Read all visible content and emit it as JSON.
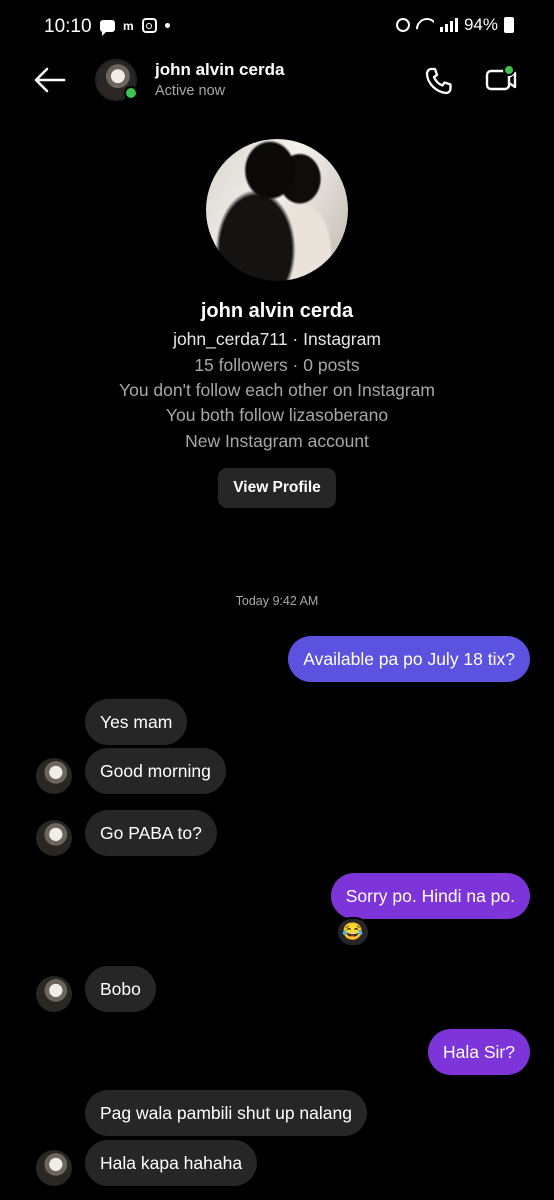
{
  "status_bar": {
    "time": "10:10",
    "battery": "94%",
    "left_icons": [
      "message-icon",
      "m-icon",
      "instagram-icon",
      "dot-icon"
    ],
    "right_icons": [
      "alarm-icon",
      "wifi-icon",
      "signal-icon",
      "battery-icon"
    ],
    "sb_m": "m"
  },
  "header": {
    "name": "john alvin cerda",
    "status": "Active now",
    "icons": [
      "back-arrow-icon",
      "phone-icon",
      "video-call-icon"
    ]
  },
  "profile": {
    "name": "john alvin cerda",
    "handle": "john_cerda711 · Instagram",
    "stats": "15 followers · 0 posts",
    "follow_status": "You don't follow each other on Instagram",
    "mutual": "You both follow lizasoberano",
    "account_note": "New Instagram account",
    "view_profile_label": "View Profile"
  },
  "timestamp": "Today 9:42 AM",
  "messages": [
    {
      "direction": "outgoing",
      "text": "Available pa po July 18 tix?"
    },
    {
      "direction": "incoming",
      "text": "Yes mam"
    },
    {
      "direction": "incoming",
      "text": "Good morning"
    },
    {
      "direction": "incoming",
      "text": "Go PABA to?"
    },
    {
      "direction": "outgoing",
      "text": "Sorry po. Hindi na po.",
      "reaction": "😂"
    },
    {
      "direction": "incoming",
      "text": "Bobo"
    },
    {
      "direction": "outgoing",
      "text": "Hala Sir?"
    },
    {
      "direction": "incoming",
      "text": "Pag wala pambili shut up nalang"
    },
    {
      "direction": "incoming",
      "text": "Hala kapa hahaha"
    }
  ],
  "colors": {
    "background": "#000000",
    "outgoing_bubble_top": "#5b52e0",
    "outgoing_bubble_bottom": "#7d35d9",
    "incoming_bubble": "#262626",
    "online_indicator": "#3ec24f",
    "secondary_text": "#a8a8a8"
  }
}
